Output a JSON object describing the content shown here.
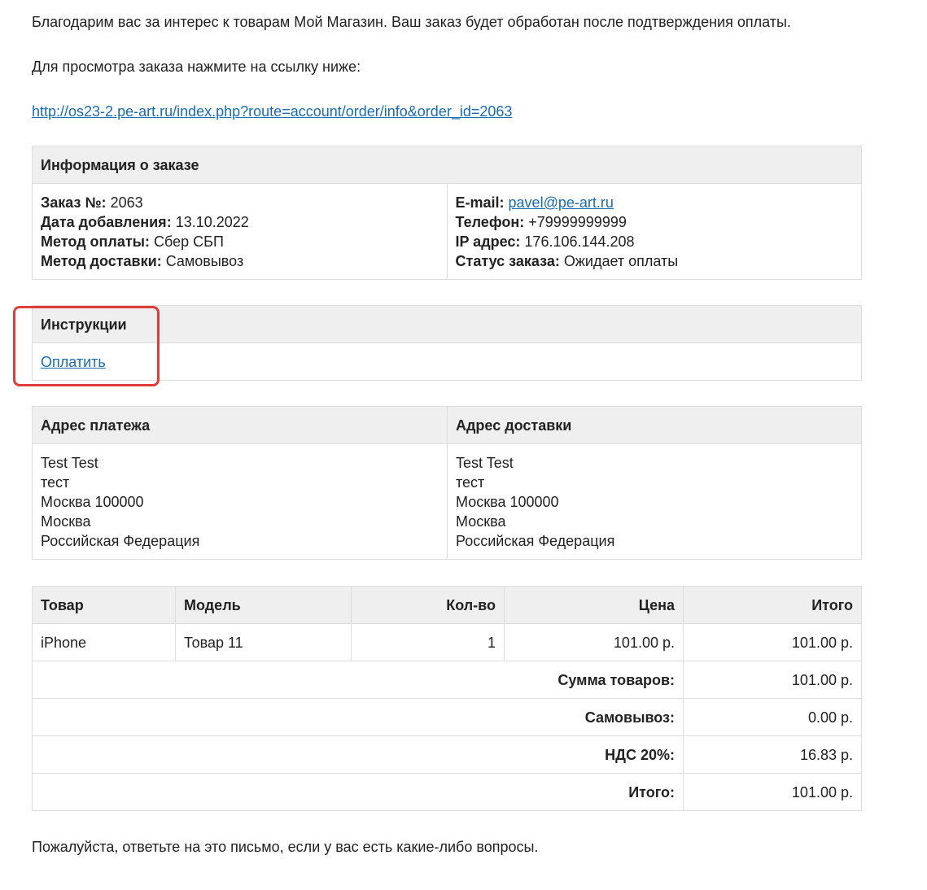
{
  "intro": {
    "thanks": "Благодарим вас за интерес к товарам Мой Магазин. Ваш заказ будет обработан после подтверждения оплаты.",
    "view_prompt": "Для просмотра заказа нажмите на ссылку ниже:",
    "order_link": "http://os23-2.pe-art.ru/index.php?route=account/order/info&order_id=2063"
  },
  "order_info": {
    "header": "Информация о заказе",
    "left": [
      {
        "label": "Заказ №:",
        "value": "2063"
      },
      {
        "label": "Дата добавления:",
        "value": "13.10.2022"
      },
      {
        "label": "Метод оплаты:",
        "value": "Сбер СБП"
      },
      {
        "label": "Метод доставки:",
        "value": "Самовывоз"
      }
    ],
    "email": {
      "label": "E-mail:",
      "value": "pavel@pe-art.ru"
    },
    "right": [
      {
        "label": "Телефон:",
        "value": "+79999999999"
      },
      {
        "label": "IP адрес:",
        "value": "176.106.144.208"
      },
      {
        "label": "Статус заказа:",
        "value": "Ожидает оплаты"
      }
    ]
  },
  "instructions": {
    "header": "Инструкции",
    "pay_link": "Оплатить",
    "highlight_color": "#e03c3c"
  },
  "addresses": {
    "payment_header": "Адрес платежа",
    "shipping_header": "Адрес доставки",
    "payment_lines": [
      "Test Test",
      "тест",
      "Москва 100000",
      "Москва",
      "Российская Федерация"
    ],
    "shipping_lines": [
      "Test Test",
      "тест",
      "Москва 100000",
      "Москва",
      "Российская Федерация"
    ]
  },
  "products": {
    "headers": {
      "product": "Товар",
      "model": "Модель",
      "qty": "Кол-во",
      "price": "Цена",
      "total": "Итого"
    },
    "rows": [
      {
        "product": "iPhone",
        "model": "Товар 11",
        "qty": "1",
        "price": "101.00 р.",
        "total": "101.00 р."
      }
    ],
    "totals": [
      {
        "label": "Сумма товаров:",
        "value": "101.00 р."
      },
      {
        "label": "Самовывоз:",
        "value": "0.00 р."
      },
      {
        "label": "НДС 20%:",
        "value": "16.83 р."
      },
      {
        "label": "Итого:",
        "value": "101.00 р."
      }
    ]
  },
  "footer": {
    "question": "Пожалуйста, ответьте на это письмо, если у вас есть какие-либо вопросы."
  },
  "colors": {
    "link": "#1a6bb3",
    "header_bg": "#efefef",
    "border": "#dddddd"
  }
}
